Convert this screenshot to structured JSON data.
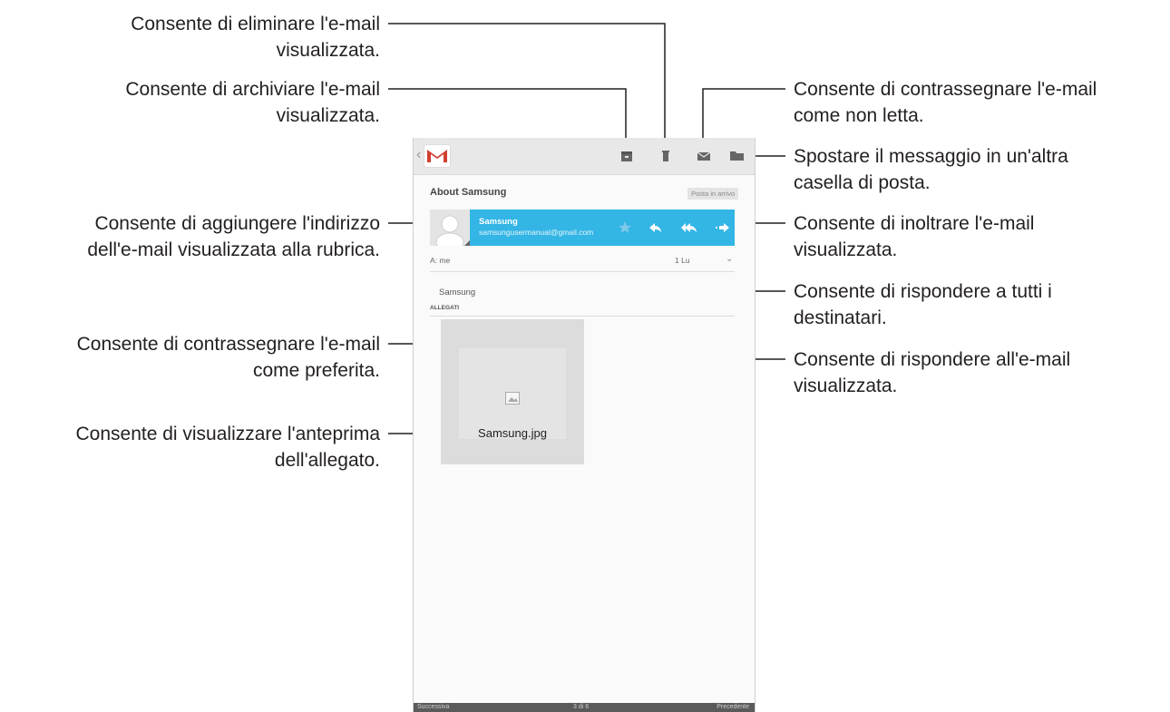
{
  "callouts": {
    "delete": [
      "Consente di eliminare l'e-mail",
      "visualizzata."
    ],
    "archive": [
      "Consente di archiviare l'e-mail",
      "visualizzata."
    ],
    "add_contact": [
      "Consente di aggiungere l'indirizzo",
      "dell'e-mail visualizzata alla rubrica."
    ],
    "favorite": [
      "Consente di contrassegnare l'e-mail",
      "come preferita."
    ],
    "preview": [
      "Consente di visualizzare l'anteprima",
      "dell'allegato."
    ],
    "unread": [
      "Consente di contrassegnare l'e-mail",
      "come non letta."
    ],
    "move": [
      "Spostare il messaggio in un'altra",
      "casella di posta."
    ],
    "forward": [
      "Consente di inoltrare l'e-mail",
      "visualizzata."
    ],
    "reply_all": [
      "Consente di rispondere a tutti i",
      "destinatari."
    ],
    "reply": [
      "Consente di rispondere all'e-mail",
      "visualizzata."
    ]
  },
  "email": {
    "subject": "About Samsung",
    "label": "Posta in arrivo",
    "sender_name": "Samsung",
    "sender_email": "samsungusermanual@gmail.com",
    "to": "A: me",
    "date": "1 Lu",
    "body": "Samsung",
    "attachments_header": "ALLEGATI",
    "attachment_name": "Samsung.jpg"
  },
  "footer": {
    "next": "Successiva",
    "position": "3 di 6",
    "previous": "Precedente"
  },
  "colors": {
    "accent": "#33b5e5",
    "gmail_red": "#d23f31"
  },
  "icons": [
    "chevron-left-icon",
    "gmail-logo",
    "archive-icon",
    "delete-icon",
    "mark-unread-icon",
    "folder-icon",
    "contact-avatar",
    "star-icon",
    "reply-icon",
    "reply-all-icon",
    "forward-icon",
    "chevron-down-icon",
    "image-icon"
  ]
}
